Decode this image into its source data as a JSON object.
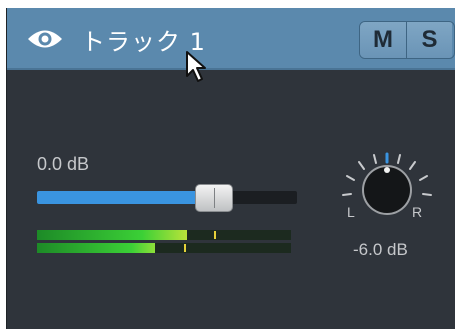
{
  "track": {
    "name": "トラック 1",
    "mute_label": "M",
    "solo_label": "S"
  },
  "volume": {
    "label": "0.0 dB",
    "fader_level": 0.66
  },
  "meters": [
    {
      "level": 0.59,
      "peak": 0.69
    },
    {
      "level": 0.46,
      "peak": 0.58
    }
  ],
  "pan": {
    "left_label": "L",
    "right_label": "R",
    "value_label": "-6.0 dB"
  },
  "colors": {
    "header": "#5b89ad",
    "panel": "#2f343b",
    "accent": "#3a94e0",
    "meter_green": "#35c23a",
    "meter_yellow": "#e5d23a"
  },
  "icons": {
    "visibility": "eye-icon",
    "cursor": "mouse-pointer-icon"
  }
}
